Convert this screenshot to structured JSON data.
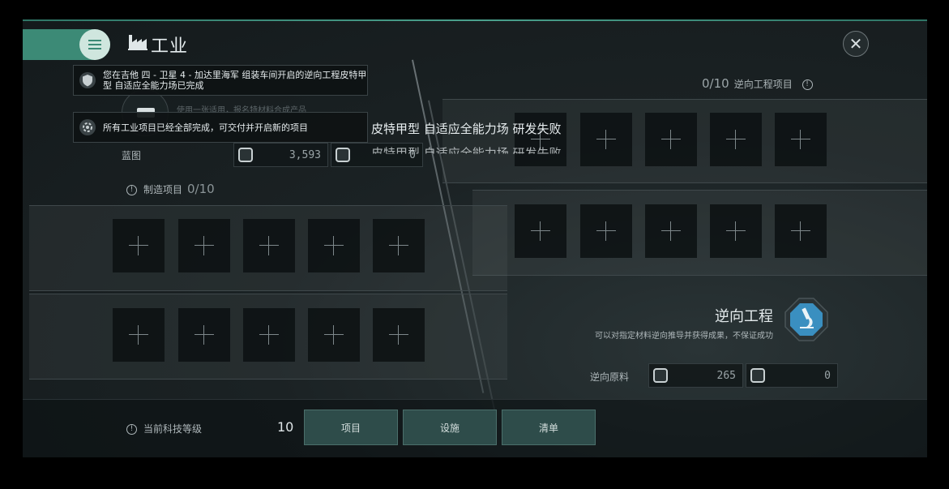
{
  "header": {
    "title": "工业"
  },
  "notifications": [
    {
      "text": "您在吉他 四 - 卫星 4 - 加达里海军 组装车间开启的逆向工程皮特甲型 自适应全能力场已完成"
    },
    {
      "text": "所有工业项目已经全部完成，可交付并开启新的项目"
    }
  ],
  "ghost_text": "使用一张适用，报名特材料合成产品",
  "blueprint": {
    "label": "蓝图",
    "cost1": "3,593",
    "cost2": "0"
  },
  "failure": {
    "line1": "皮特甲型 自适应全能力场 研发失败",
    "line2": "皮特甲型 自适应全能力场 研发失败"
  },
  "manufacturing": {
    "label": "制造项目",
    "count": "0/10"
  },
  "reverse": {
    "count": "0/10",
    "label": "逆向工程项目",
    "title": "逆向工程",
    "desc": "可以对指定材料逆向推导并获得成果，不保证成功",
    "material_label": "逆向原料",
    "material_cost1": "265",
    "material_cost2": "0"
  },
  "bottom": {
    "tech_label": "当前科技等级",
    "tech_value": "10",
    "tabs": [
      "项目",
      "设施",
      "清单"
    ]
  },
  "colors": {
    "accent": "#3c8a76",
    "tab_bg": "#2e4c4a"
  },
  "icons": [
    "menu-icon",
    "factory-icon",
    "close-icon",
    "shield-icon",
    "gear-icon",
    "microscope-icon",
    "info-icon",
    "currency-icon"
  ]
}
